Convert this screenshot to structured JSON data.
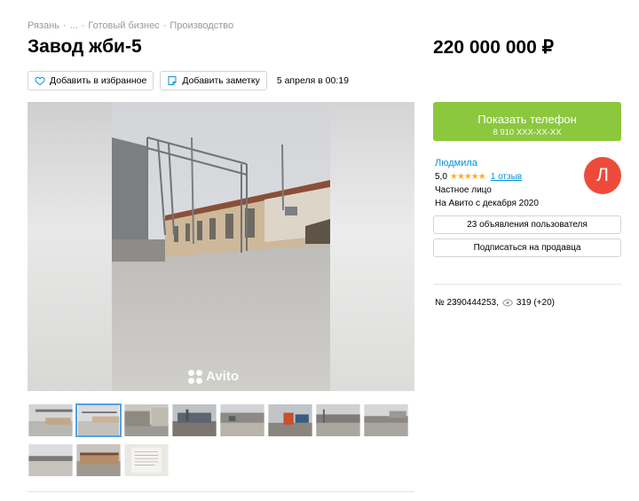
{
  "breadcrumb": {
    "city": "Рязань",
    "sep1": "·",
    "ellipsis": "...",
    "sep2": "·",
    "category": "Готовый бизнес",
    "sep3": "·",
    "subcategory": "Производство"
  },
  "listing": {
    "title": "Завод жби-5",
    "price": "220 000 000 ₽",
    "date": "5 апреля в 00:19",
    "favorite_label": "Добавить в избранное",
    "note_label": "Добавить заметку",
    "number": "№ 2390444253,",
    "views": "319 (+20)"
  },
  "gallery": {
    "watermark": "Avito",
    "thumbnail_count": 10,
    "active_thumbnail": 2
  },
  "contact": {
    "show_phone_label": "Показать телефон",
    "phone_masked": "8 910 XXX-XX-XX",
    "button_color": "#8bc83d"
  },
  "seller": {
    "name": "Людмила",
    "rating": "5,0",
    "stars": "★★★★★",
    "reviews": "1 отзыв",
    "type": "Частное лицо",
    "since": "На Авито с декабря 2020",
    "avatar_letter": "Л",
    "avatar_color": "#ee4a3c",
    "ads_button": "23 объявления пользователя",
    "subscribe_button": "Подписаться на продавца"
  }
}
